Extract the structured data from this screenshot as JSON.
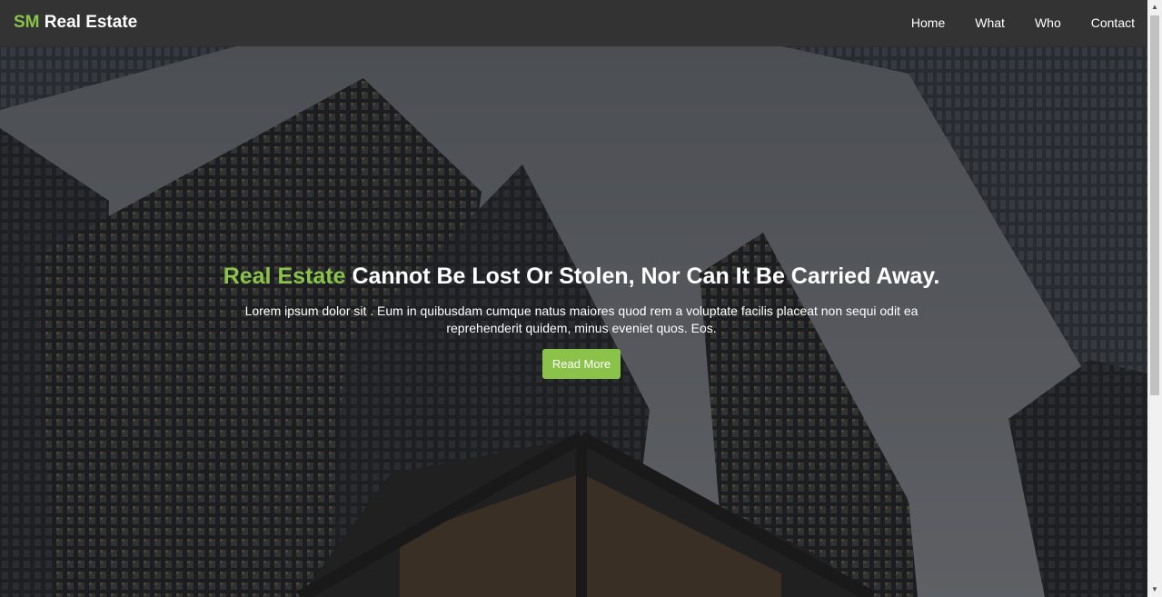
{
  "navbar": {
    "brand_accent": "SM",
    "brand_rest": "Real Estate",
    "links": [
      "Home",
      "What",
      "Who",
      "Contact"
    ]
  },
  "hero": {
    "title_accent": "Real Estate",
    "title_rest": "Cannot Be Lost Or Stolen, Nor Can It Be Carried Away.",
    "text": "Lorem ipsum dolor sit . Eum in quibusdam cumque natus maiores quod rem a voluptate facilis placeat non sequi odit ea reprehenderit quidem, minus eveniet quos. Eos.",
    "button_label": "Read More",
    "background_icon": "skyscrapers-image"
  },
  "colors": {
    "accent": "#8bc34a",
    "navbar_bg": "#333333",
    "text": "#ffffff"
  },
  "scrollbar": {
    "up_icon": "arrow-up-icon",
    "down_icon": "arrow-down-icon"
  }
}
